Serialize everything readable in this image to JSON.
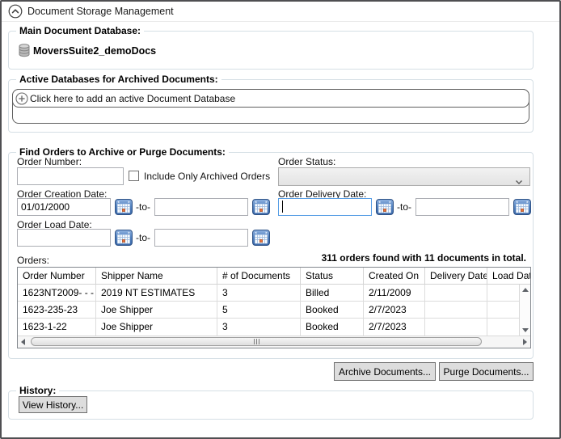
{
  "window": {
    "title": "Document Storage Management"
  },
  "main_database": {
    "caption": "Main Document Database:",
    "database_name": "MoversSuite2_demoDocs"
  },
  "active_databases": {
    "caption": "Active Databases for Archived Documents:",
    "add_button_label": "Click here to add an active Document Database"
  },
  "find_orders": {
    "caption": "Find Orders to Archive or Purge Documents:",
    "order_number_label": "Order Number:",
    "order_number_value": "",
    "include_archived_label": "Include Only Archived Orders",
    "include_archived_checked": false,
    "order_status_label": "Order Status:",
    "order_status_value": "",
    "to_separator": "-to-",
    "creation_date_label": "Order Creation Date:",
    "creation_date_from": "01/01/2000",
    "creation_date_to": "",
    "delivery_date_label": "Order Delivery Date:",
    "delivery_date_from": "",
    "delivery_date_to": "",
    "load_date_label": "Order Load Date:",
    "load_date_from": "",
    "load_date_to": "",
    "results_summary": "311 orders found with 11 documents in total.",
    "orders_label": "Orders:",
    "orders_table": {
      "columns": [
        "Order Number",
        "Shipper Name",
        "# of Documents",
        "Status",
        "Created On",
        "Delivery Date",
        "Load Date"
      ],
      "rows": [
        [
          "1623NT2009- - -",
          "2019 NT ESTIMATES",
          "3",
          "Billed",
          "2/11/2009",
          "",
          ""
        ],
        [
          "1623-235-23",
          "Joe Shipper",
          "5",
          "Booked",
          "2/7/2023",
          "",
          ""
        ],
        [
          "1623-1-22",
          "Joe Shipper",
          "3",
          "Booked",
          "2/7/2023",
          "",
          ""
        ]
      ]
    }
  },
  "actions": {
    "archive_button": "Archive Documents...",
    "purge_button": "Purge Documents..."
  },
  "history": {
    "caption": "History:",
    "view_history_button": "View History..."
  },
  "icons": {
    "expander": "chevron-up-circle-icon",
    "main_database": "database-icon",
    "add_database": "plus-circle-icon",
    "date_pickers": "calendar-icon",
    "status_dropdown": "chevron-down-icon"
  },
  "colors": {
    "focus_border": "#569de5",
    "groupbox_border": "#d5dfe5",
    "button_face": "#dddddd",
    "calendar_blue": "#4376b8",
    "calendar_orange": "#e8733e"
  }
}
